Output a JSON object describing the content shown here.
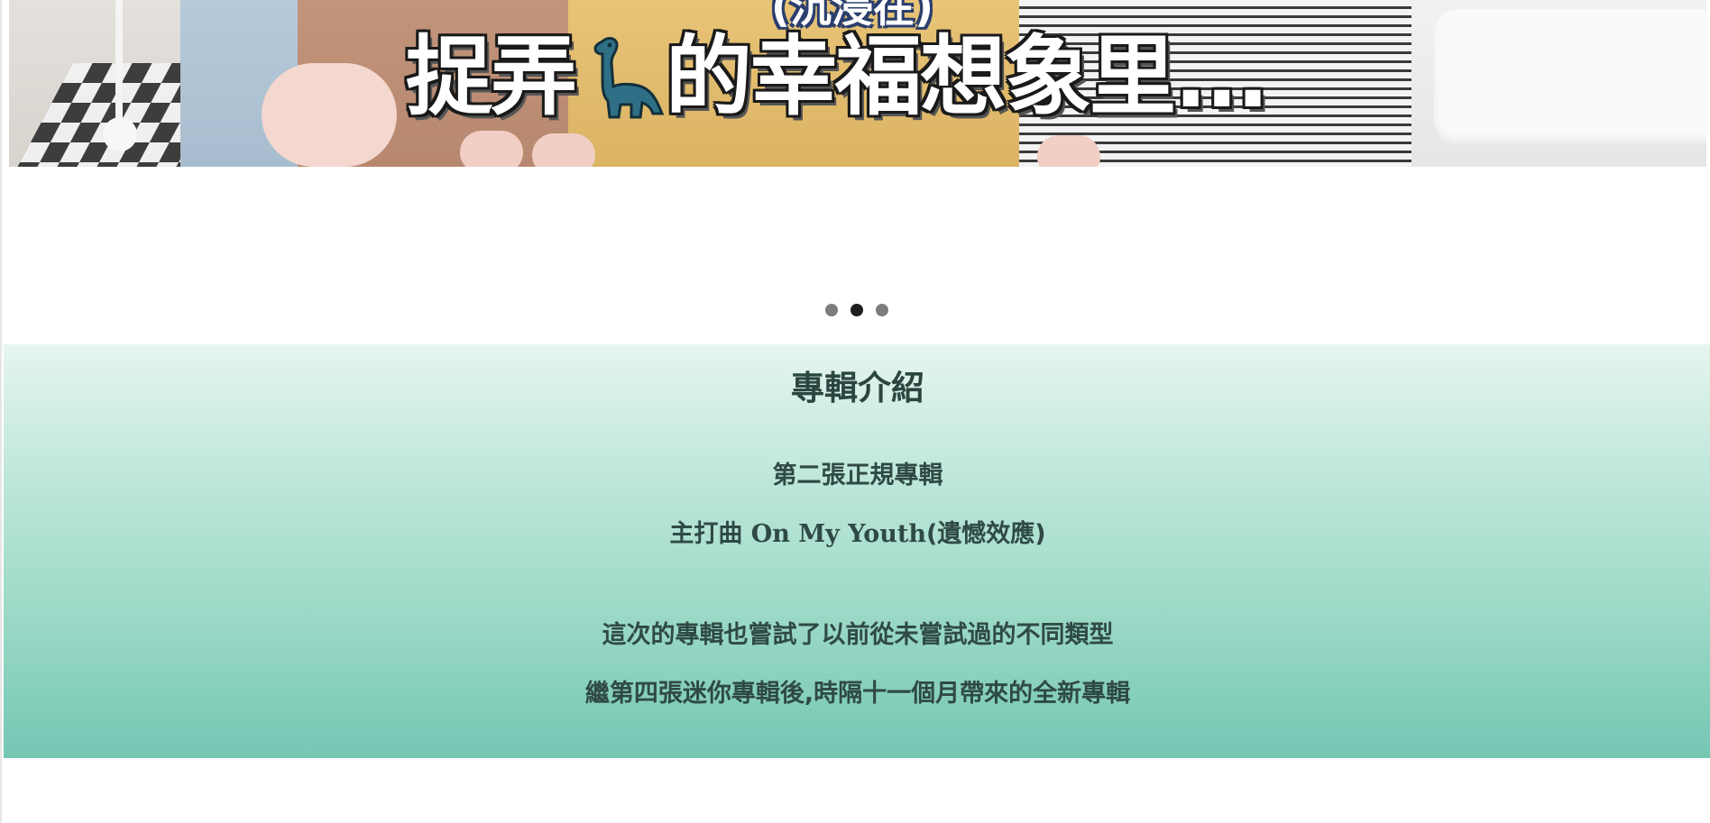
{
  "banner": {
    "headline_part1": "捉弄",
    "headline_part2": "的幸福想象里...",
    "subtitle_fragment": "(沉浸在)",
    "icon": "dinosaur-icon"
  },
  "carousel": {
    "slide_count": 3,
    "active_index": 1
  },
  "album_intro": {
    "title": "專輯介紹",
    "line1": "第二張正規專輯",
    "line2_prefix": "主打曲",
    "line2_title": "On My Youth",
    "line2_suffix": "(遺憾效應)",
    "line3": "這次的專輯也嘗試了以前從未嘗試過的不同類型",
    "line4": "繼第四張迷你專輯後,時隔十一個月帶來的全新專輯"
  },
  "colors": {
    "section_gradient_top": "#e6f5ef",
    "section_gradient_bottom": "#74c7b3",
    "text": "#2f4a44",
    "dot_inactive": "#7d7d7d",
    "dot_active": "#1f1f1f"
  }
}
